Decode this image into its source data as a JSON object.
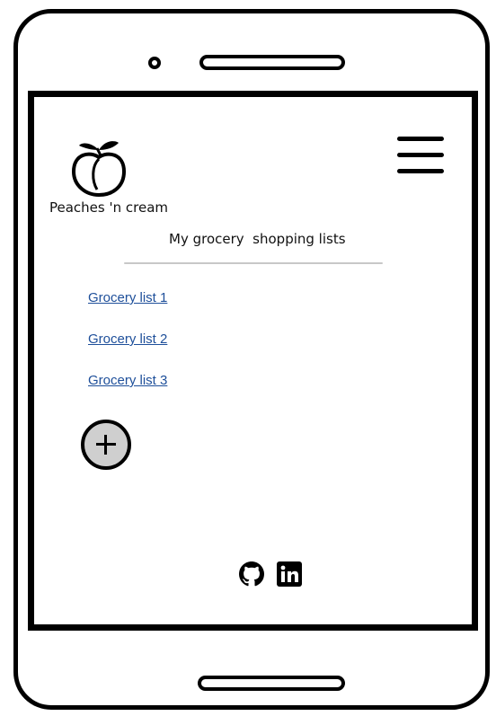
{
  "brand": {
    "name": "Peaches 'n cream"
  },
  "page": {
    "title": "My grocery  shopping lists"
  },
  "lists": [
    {
      "label": "Grocery list 1"
    },
    {
      "label": "Grocery list 2"
    },
    {
      "label": "Grocery list 3"
    }
  ],
  "icons": {
    "logo": "peach-icon",
    "menu": "hamburger-menu-icon",
    "add": "plus-icon",
    "social": [
      "github-icon",
      "linkedin-icon"
    ]
  },
  "colors": {
    "link": "#1e4f9a",
    "add_button_fill": "#cfcfcf"
  }
}
